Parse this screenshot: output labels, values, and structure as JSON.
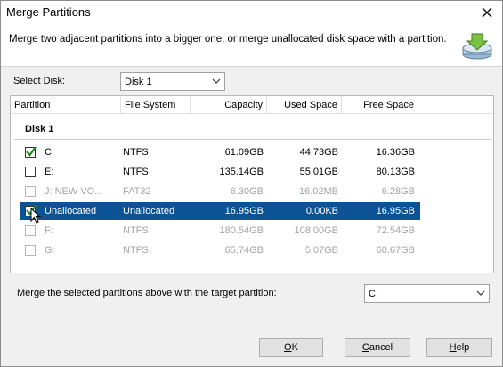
{
  "window": {
    "title": "Merge Partitions"
  },
  "header": {
    "description": "Merge two adjacent partitions into a bigger one, or merge unallocated disk space with a partition."
  },
  "disk_selector": {
    "label": "Select Disk:",
    "value": "Disk 1"
  },
  "table": {
    "columns": [
      "Partition",
      "File System",
      "Capacity",
      "Used Space",
      "Free Space"
    ],
    "group": "Disk 1",
    "rows": [
      {
        "checked": true,
        "enabled": true,
        "selected": false,
        "partition": "C:",
        "fs": "NTFS",
        "capacity": "61.09GB",
        "used": "44.73GB",
        "free": "16.36GB"
      },
      {
        "checked": false,
        "enabled": true,
        "selected": false,
        "partition": "E:",
        "fs": "NTFS",
        "capacity": "135.14GB",
        "used": "55.01GB",
        "free": "80.13GB"
      },
      {
        "checked": false,
        "enabled": false,
        "selected": false,
        "partition": "J: NEW VO...",
        "fs": "FAT32",
        "capacity": "6.30GB",
        "used": "16.02MB",
        "free": "6.28GB"
      },
      {
        "checked": true,
        "enabled": true,
        "selected": true,
        "partition": "Unallocated",
        "fs": "Unallocated",
        "capacity": "16.95GB",
        "used": "0.00KB",
        "free": "16.95GB"
      },
      {
        "checked": false,
        "enabled": false,
        "selected": false,
        "partition": "F:",
        "fs": "NTFS",
        "capacity": "180.54GB",
        "used": "108.00GB",
        "free": "72.54GB"
      },
      {
        "checked": false,
        "enabled": false,
        "selected": false,
        "partition": "G:",
        "fs": "NTFS",
        "capacity": "65.74GB",
        "used": "5.07GB",
        "free": "60.67GB"
      }
    ]
  },
  "target": {
    "label": "Merge the selected partitions above with the target partition:",
    "value": "C:"
  },
  "buttons": {
    "ok": {
      "label": "OK",
      "mnemonic": "O",
      "rest": "K"
    },
    "cancel": {
      "label": "Cancel",
      "mnemonic": "C",
      "rest": "ancel"
    },
    "help": {
      "label": "Help",
      "mnemonic": "H",
      "rest": "elp"
    }
  },
  "icons": {
    "close": "close-icon",
    "header": "merge-partition-icon",
    "dropdown": "chevron-down-icon",
    "checkmark": "checkmark-icon",
    "cursor": "mouse-cursor-icon"
  },
  "colors": {
    "selection": "#0b5394",
    "check_green": "#1f8a1f",
    "disabled_text": "#a3a3a3"
  }
}
